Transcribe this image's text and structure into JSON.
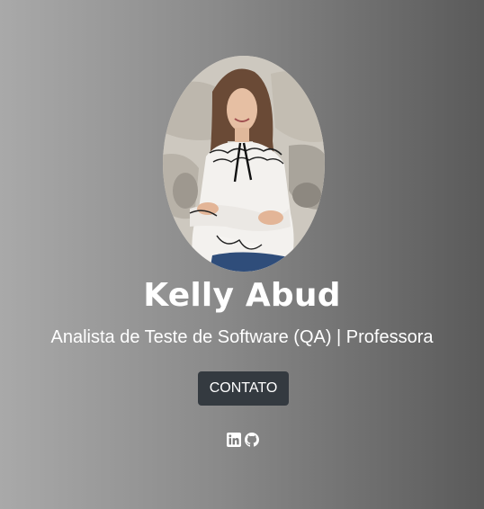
{
  "profile": {
    "name": "Kelly Abud",
    "role": "Analista de Teste de Software (QA) | Professora",
    "avatar_alt": "Kelly Abud"
  },
  "actions": {
    "contact_label": "CONTATO"
  },
  "social": {
    "links": [
      {
        "icon": "linkedin-icon"
      },
      {
        "icon": "github-icon"
      }
    ]
  },
  "colors": {
    "background_gradient": [
      "#a9a9a9",
      "#8a8a8a",
      "#5a5a5a"
    ],
    "button_bg": "#343a40",
    "text": "#ffffff"
  }
}
